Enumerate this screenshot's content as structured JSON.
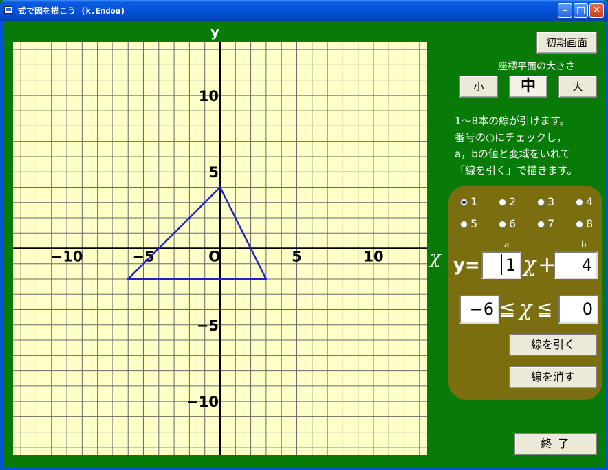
{
  "window": {
    "title": "式で図を描こう (k.Endou)",
    "min_glyph": "–",
    "max_glyph": "□",
    "close_glyph": "✕"
  },
  "graph": {
    "x_axis_label": "χ",
    "y_axis_label": "y",
    "x_tick_labels": [
      "−10",
      "−5",
      "O",
      "5",
      "10"
    ],
    "y_tick_labels": [
      "10",
      "5",
      "−5",
      "−10"
    ],
    "grid_range": {
      "xmin": -13.5,
      "xmax": 13.5,
      "ymin": -13.5,
      "ymax": 13.5
    },
    "line_color": "#1a22c8",
    "segments": [
      {
        "from": [
          -6,
          -2
        ],
        "to": [
          0,
          4
        ]
      },
      {
        "from": [
          0,
          4
        ],
        "to": [
          3,
          -2
        ]
      },
      {
        "from": [
          -6,
          -2
        ],
        "to": [
          3,
          -2
        ]
      }
    ]
  },
  "controls": {
    "initial_screen_button": "初期画面",
    "size_caption": "座標平面の大きさ",
    "size_small": "小",
    "size_medium": "中",
    "size_large": "大",
    "instructions": "1～8本の線が引けます。\n番号の○にチェックし，\na，bの値と変域をいれて\n「線を引く」で描きます。",
    "line_numbers": [
      "1",
      "2",
      "3",
      "4",
      "5",
      "6",
      "7",
      "8"
    ],
    "selected_line": "1",
    "a_label": "a",
    "b_label": "b",
    "eq_y": "y=",
    "eq_x": "χ",
    "eq_plus": "+",
    "leq": "≦",
    "a_value": "1",
    "b_value": "4",
    "range_min": "−6",
    "range_max": "0",
    "draw_button": "線を引く",
    "erase_button": "線を消す",
    "end_button": "終 了"
  }
}
